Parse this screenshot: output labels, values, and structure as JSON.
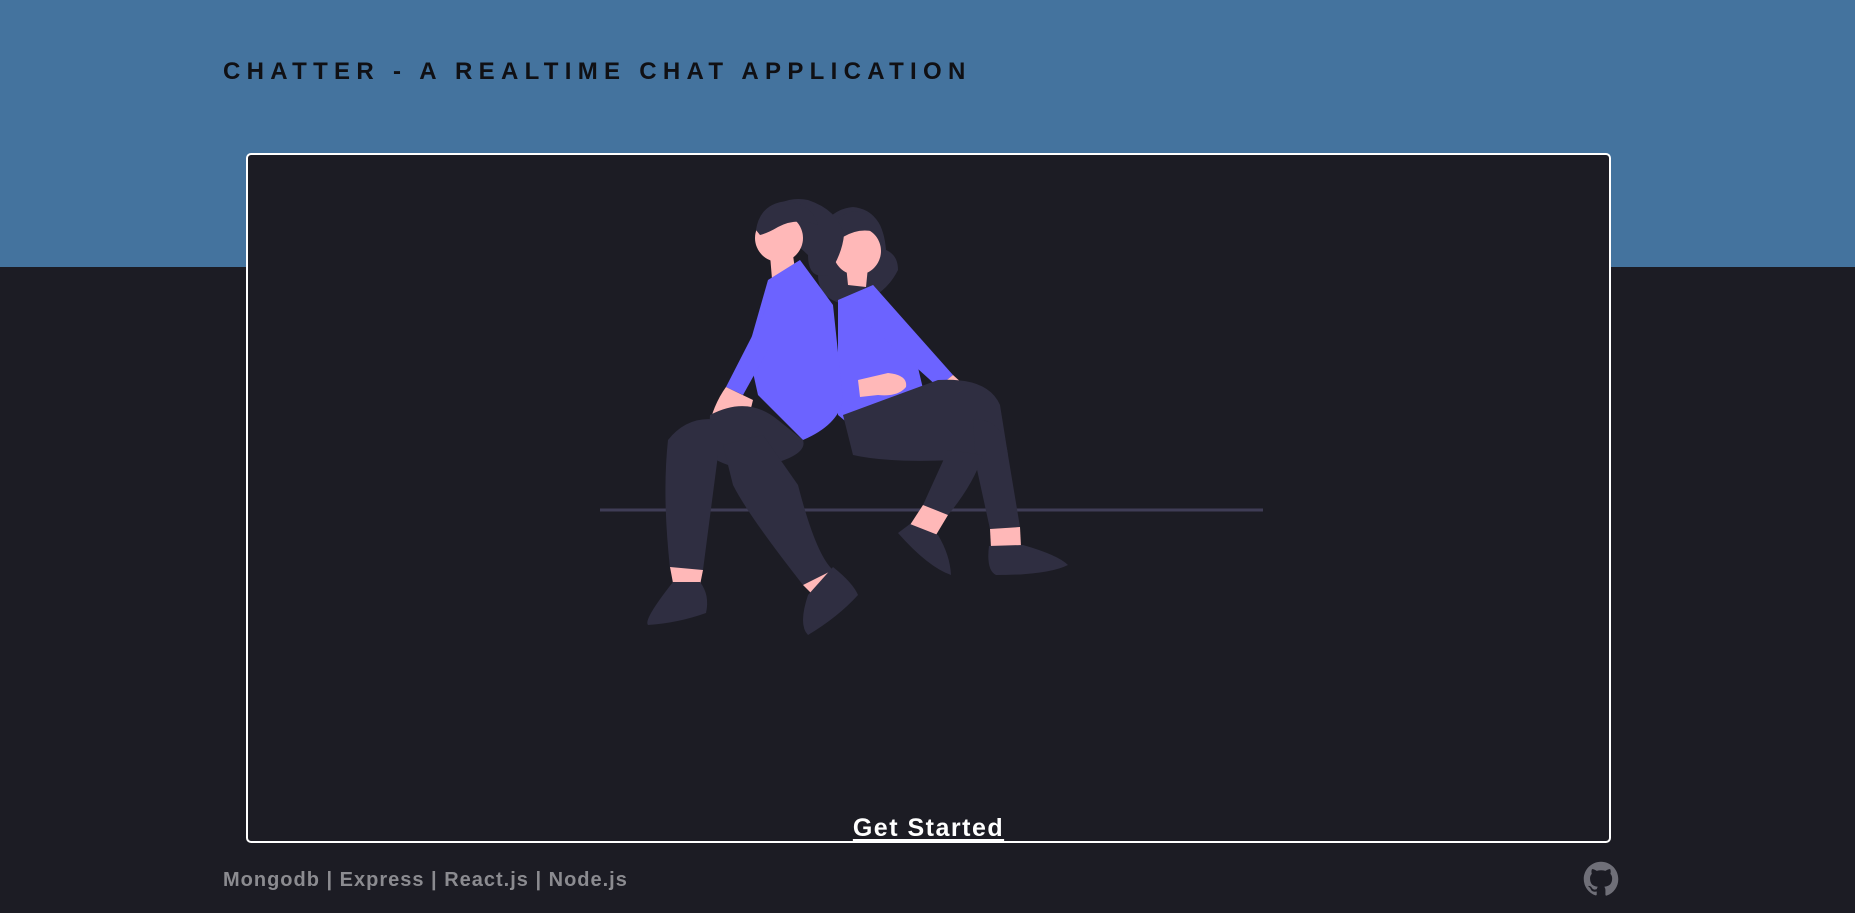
{
  "header": {
    "title": "CHATTER - A REALTIME CHAT APPLICATION"
  },
  "hero": {
    "illustration_icon": "two-people-sitting-back-to-back-illustration",
    "cta_label": "Get Started"
  },
  "footer": {
    "tech_stack": "Mongodb | Express | React.js | Node.js",
    "github_icon": "github-icon"
  },
  "colors": {
    "header_band": "#44739e",
    "background": "#1c1c24",
    "shirt_accent": "#6c63ff",
    "skin": "#ffb8b8",
    "hair_pants": "#2f2e41",
    "footer_text": "#8b8b90"
  }
}
